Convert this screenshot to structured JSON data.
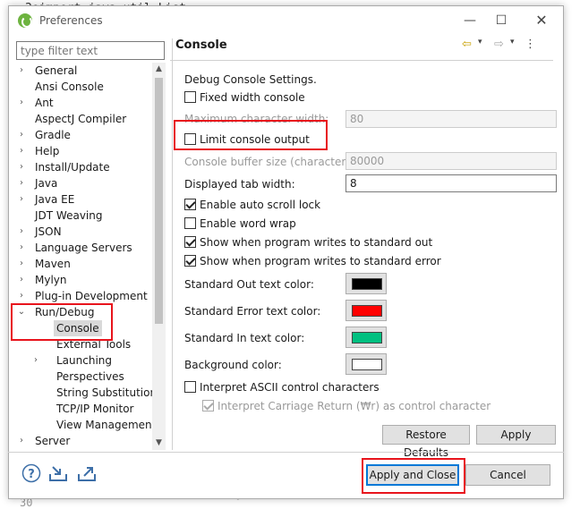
{
  "background": {
    "code_line_top": "3⊕import java.util.List;",
    "code_line_bottom_left": "30",
    "code_line_bottom_mid": "); }"
  },
  "window": {
    "title": "Preferences",
    "minimize_glyph": "—",
    "maximize_glyph": "☐",
    "close_glyph": "✕"
  },
  "sidebar": {
    "filter_placeholder": "type filter text",
    "items": [
      {
        "label": "General",
        "expander": "›",
        "level": 0
      },
      {
        "label": "Ansi Console",
        "expander": "",
        "level": 0
      },
      {
        "label": "Ant",
        "expander": "›",
        "level": 0
      },
      {
        "label": "AspectJ Compiler",
        "expander": "",
        "level": 0
      },
      {
        "label": "Gradle",
        "expander": "›",
        "level": 0
      },
      {
        "label": "Help",
        "expander": "›",
        "level": 0
      },
      {
        "label": "Install/Update",
        "expander": "›",
        "level": 0
      },
      {
        "label": "Java",
        "expander": "›",
        "level": 0
      },
      {
        "label": "Java EE",
        "expander": "›",
        "level": 0
      },
      {
        "label": "JDT Weaving",
        "expander": "",
        "level": 0
      },
      {
        "label": "JSON",
        "expander": "›",
        "level": 0
      },
      {
        "label": "Language Servers",
        "expander": "›",
        "level": 0
      },
      {
        "label": "Maven",
        "expander": "›",
        "level": 0
      },
      {
        "label": "Mylyn",
        "expander": "›",
        "level": 0
      },
      {
        "label": "Plug-in Development",
        "expander": "›",
        "level": 0
      },
      {
        "label": "Run/Debug",
        "expander": "⌄",
        "level": 0
      },
      {
        "label": "Console",
        "expander": "",
        "level": 1,
        "selected": true
      },
      {
        "label": "External Tools",
        "expander": "",
        "level": 1
      },
      {
        "label": "Launching",
        "expander": "›",
        "level": 1
      },
      {
        "label": "Perspectives",
        "expander": "",
        "level": 1
      },
      {
        "label": "String Substitution",
        "expander": "",
        "level": 1
      },
      {
        "label": "TCP/IP Monitor",
        "expander": "",
        "level": 1
      },
      {
        "label": "View Management",
        "expander": "",
        "level": 1
      },
      {
        "label": "Server",
        "expander": "›",
        "level": 0
      }
    ],
    "scroll_up_glyph": "▲",
    "scroll_down_glyph": "▼"
  },
  "panel": {
    "title": "Console",
    "nav_back": "⇦",
    "nav_forward": "⇨",
    "nav_dropdown": "▾",
    "nav_menu": "⋮",
    "description": "Debug Console Settings.",
    "fixed_width_label": "Fixed width console",
    "fixed_width_checked": false,
    "max_char_width_label": "Maximum character width:",
    "max_char_width_value": "80",
    "limit_output_label": "Limit console output",
    "limit_output_checked": false,
    "buffer_size_label": "Console buffer size (characters):",
    "buffer_size_value": "80000",
    "tab_width_label": "Displayed tab width:",
    "tab_width_value": "8",
    "auto_scroll_label": "Enable auto scroll lock",
    "auto_scroll_checked": true,
    "word_wrap_label": "Enable word wrap",
    "word_wrap_checked": false,
    "show_stdout_label": "Show when program writes to standard out",
    "show_stdout_checked": true,
    "show_stderr_label": "Show when program writes to standard error",
    "show_stderr_checked": true,
    "stdout_color_label": "Standard Out text color:",
    "stderr_color_label": "Standard Error text color:",
    "stdin_color_label": "Standard In text color:",
    "bg_color_label": "Background color:",
    "colors": {
      "stdout": "#000000",
      "stderr": "#ff0000",
      "stdin": "#00c080",
      "background": "#ffffff"
    },
    "ascii_label": "Interpret ASCII control characters",
    "ascii_checked": false,
    "cr_label": "Interpret Carriage Return (₩r) as control character",
    "cr_checked": true,
    "restore_defaults_label": "Restore Defaults",
    "apply_label": "Apply"
  },
  "footer": {
    "help_icon": "?",
    "apply_close_label": "Apply and Close",
    "cancel_label": "Cancel"
  },
  "annotations": {
    "highlight_color": "#e8141c"
  }
}
